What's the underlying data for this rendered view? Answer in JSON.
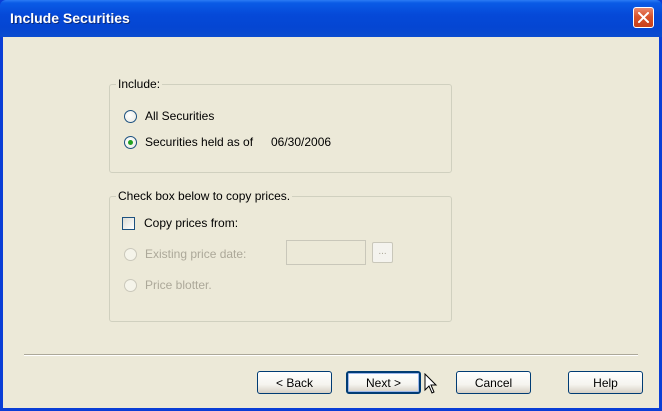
{
  "window": {
    "title": "Include Securities"
  },
  "include_group": {
    "legend": "Include:",
    "option_all": "All Securities",
    "option_held": "Securities held as of",
    "held_date": "06/30/2006",
    "selected": "held"
  },
  "copy_group": {
    "legend": "Check box below to copy prices.",
    "copy_checkbox": "Copy prices from:",
    "copy_checked": false,
    "option_existing": "Existing price date:",
    "existing_date_value": "",
    "browse_label": "...",
    "option_blotter": "Price blotter."
  },
  "buttons": {
    "back": "< Back",
    "next": "Next >",
    "cancel": "Cancel",
    "help": "Help"
  },
  "icons": {
    "close": "close-icon",
    "cursor": "mouse-cursor-icon"
  },
  "colors": {
    "titlebar": "#0549d8",
    "dialog_bg": "#ece9d8",
    "radio_dot": "#21a121",
    "close_btn": "#d8532c"
  }
}
